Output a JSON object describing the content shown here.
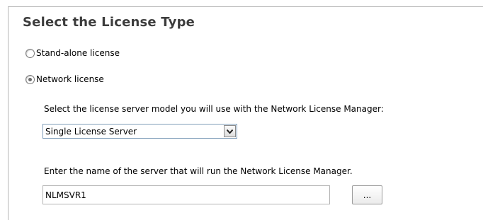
{
  "title": "Select the License Type",
  "radios": [
    {
      "label": "Stand-alone license",
      "checked": false
    },
    {
      "label": "Network license",
      "checked": true
    }
  ],
  "server_model": {
    "prompt": "Select the license server model you will use with the Network License Manager:",
    "selected": "Single License Server"
  },
  "server_name": {
    "prompt": "Enter the name of the server that will run the Network License Manager.",
    "value": "NLMSVR1"
  },
  "browse_label": "..."
}
